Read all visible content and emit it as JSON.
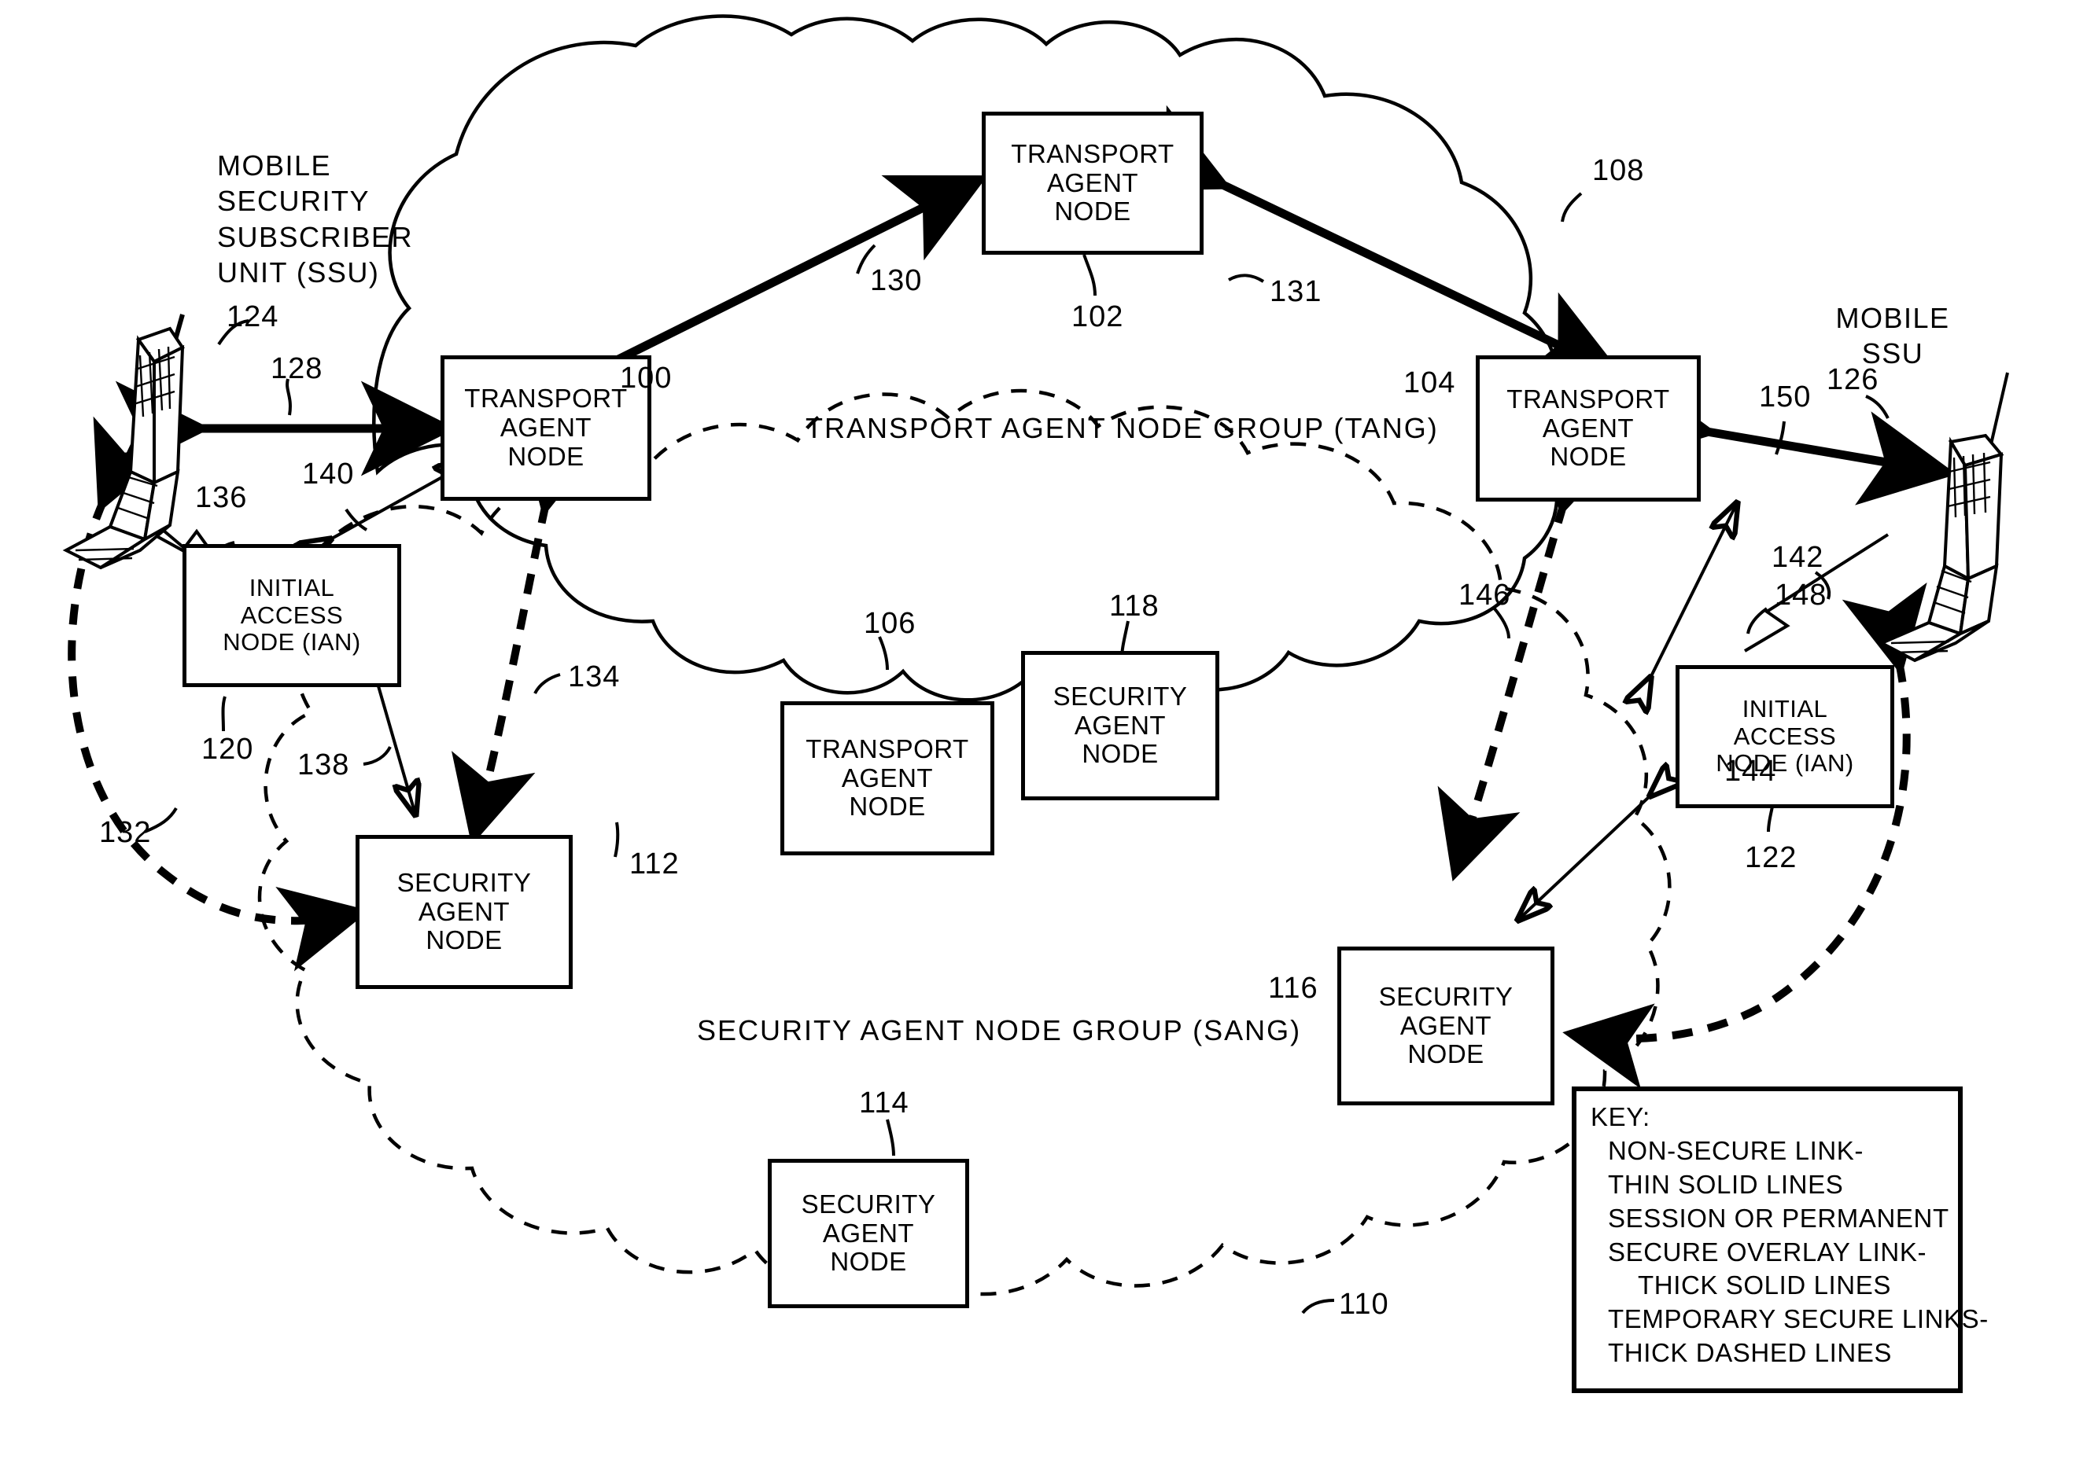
{
  "figure": {
    "type": "patent-network-diagram",
    "title_caption": "MOBILE SECURITY SUBSCRIBER UNIT (SSU)"
  },
  "captions": {
    "left_ssu": [
      "MOBILE",
      "SECURITY",
      "SUBSCRIBER",
      "UNIT (SSU)"
    ],
    "right_ssu": [
      "MOBILE",
      "SSU"
    ]
  },
  "group_labels": {
    "tang": "TRANSPORT AGENT NODE GROUP (TANG)",
    "sang": "SECURITY AGENT NODE GROUP (SANG)"
  },
  "nodes": [
    {
      "id": "tan-100",
      "ref": "100",
      "lines": [
        "TRANSPORT",
        "AGENT",
        "NODE"
      ]
    },
    {
      "id": "tan-102",
      "ref": "102",
      "lines": [
        "TRANSPORT",
        "AGENT",
        "NODE"
      ]
    },
    {
      "id": "tan-104",
      "ref": "104",
      "lines": [
        "TRANSPORT",
        "AGENT",
        "NODE"
      ]
    },
    {
      "id": "tan-106",
      "ref": "106",
      "lines": [
        "TRANSPORT",
        "AGENT",
        "NODE"
      ]
    },
    {
      "id": "san-112",
      "ref": "112",
      "lines": [
        "SECURITY",
        "AGENT",
        "NODE"
      ]
    },
    {
      "id": "san-114",
      "ref": "114",
      "lines": [
        "SECURITY",
        "AGENT",
        "NODE"
      ]
    },
    {
      "id": "san-116",
      "ref": "116",
      "lines": [
        "SECURITY",
        "AGENT",
        "NODE"
      ]
    },
    {
      "id": "san-118",
      "ref": "118",
      "lines": [
        "SECURITY",
        "AGENT",
        "NODE"
      ]
    },
    {
      "id": "ian-120",
      "ref": "120",
      "lines": [
        "INITIAL",
        "ACCESS",
        "NODE (IAN)"
      ]
    },
    {
      "id": "ian-122",
      "ref": "122",
      "lines": [
        "INITIAL",
        "ACCESS",
        "NODE (IAN)"
      ]
    }
  ],
  "reference_numerals": {
    "n100": "100",
    "n102": "102",
    "n104": "104",
    "n106": "106",
    "n108": "108",
    "n110": "110",
    "n112": "112",
    "n114": "114",
    "n116": "116",
    "n118": "118",
    "n120": "120",
    "n122": "122",
    "n124": "124",
    "n126": "126",
    "n128": "128",
    "n130": "130",
    "n131": "131",
    "n132": "132",
    "n134": "134",
    "n136": "136",
    "n138": "138",
    "n140": "140",
    "n142": "142",
    "n144": "144",
    "n146": "146",
    "n148": "148",
    "n150": "150"
  },
  "key": {
    "title": "KEY:",
    "lines": [
      "NON-SECURE LINK-",
      "THIN SOLID LINES",
      "SESSION OR PERMANENT",
      "SECURE OVERLAY LINK-",
      "THICK SOLID LINES",
      "TEMPORARY SECURE LINKS-",
      "THICK DASHED LINES"
    ]
  },
  "colors": {
    "ink": "#000000",
    "paper": "#ffffff"
  }
}
